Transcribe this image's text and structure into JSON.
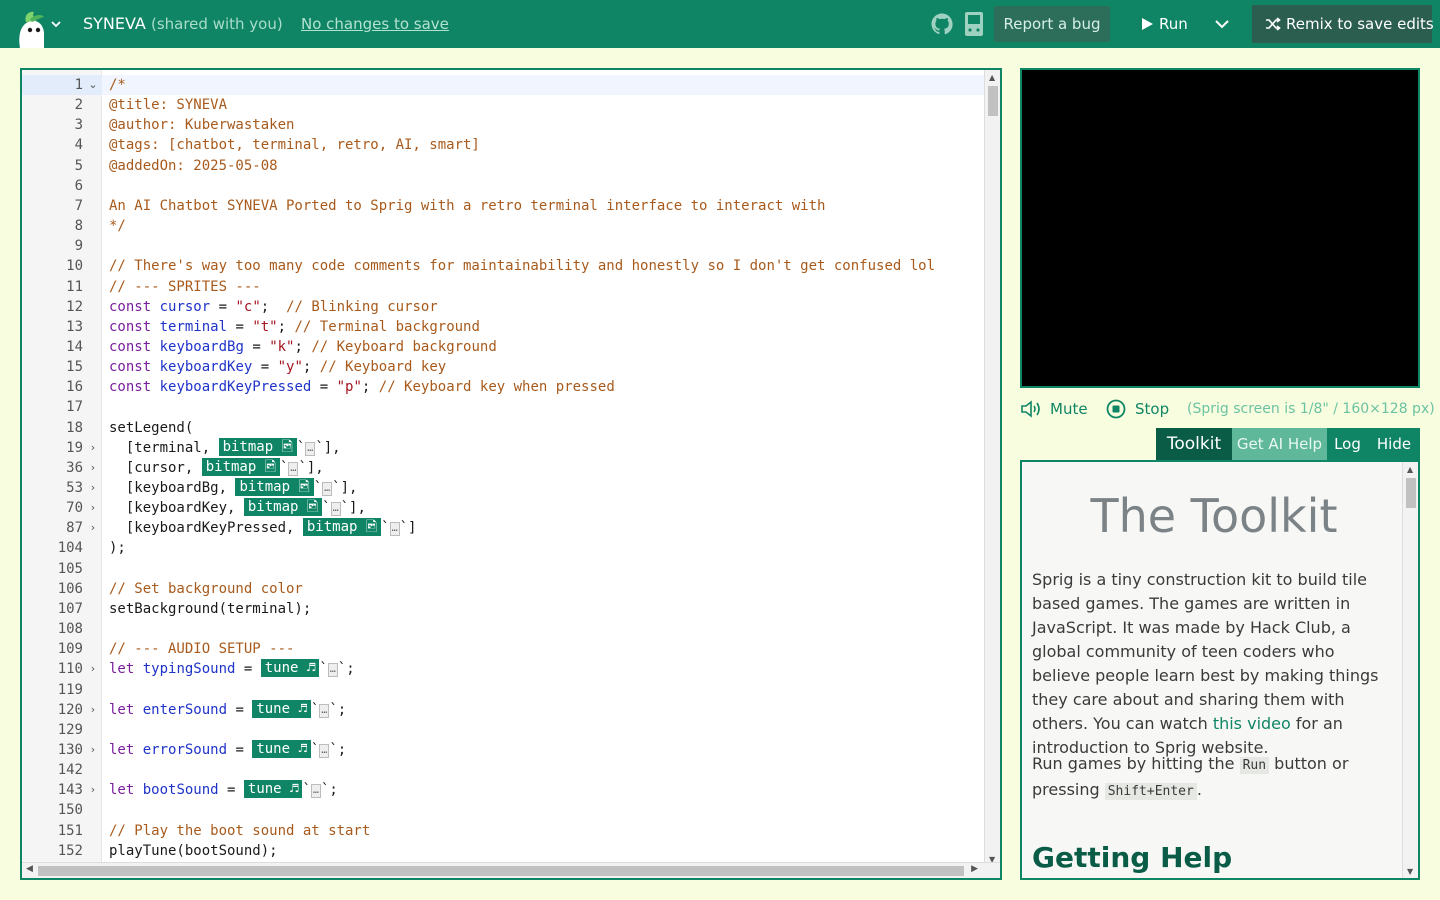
{
  "header": {
    "title": "SYNEVA",
    "shared": "(shared with you)",
    "save_status": "No changes to save",
    "report_bug": "Report a bug",
    "run": "Run",
    "remix": "Remix to save edits"
  },
  "editor": {
    "lines": [
      {
        "n": "1",
        "fold": "⌄",
        "html": "<span class=\"cm\">/*</span>"
      },
      {
        "n": "2",
        "html": "<span class=\"cm\">@title: SYNEVA</span>"
      },
      {
        "n": "3",
        "html": "<span class=\"cm\">@author: Kuberwastaken</span>"
      },
      {
        "n": "4",
        "html": "<span class=\"cm\">@tags: [chatbot, terminal, retro, AI, smart]</span>"
      },
      {
        "n": "5",
        "html": "<span class=\"cm\">@addedOn: 2025-05-08</span>"
      },
      {
        "n": "6",
        "html": ""
      },
      {
        "n": "7",
        "html": "<span class=\"cm\">An AI Chatbot SYNEVA Ported to Sprig with a retro terminal interface to interact with</span>"
      },
      {
        "n": "8",
        "html": "<span class=\"cm\">*/</span>"
      },
      {
        "n": "9",
        "html": ""
      },
      {
        "n": "10",
        "html": "<span class=\"cm\">// There's way too many code comments for maintainability and honestly so I don't get confused lol</span>"
      },
      {
        "n": "11",
        "html": "<span class=\"cm\">// --- SPRITES ---</span>"
      },
      {
        "n": "12",
        "html": "<span class=\"kw\">const</span> <span class=\"vr\">cursor</span> = <span class=\"st\">\"c\"</span>;  <span class=\"cm\">// Blinking cursor</span>"
      },
      {
        "n": "13",
        "html": "<span class=\"kw\">const</span> <span class=\"vr\">terminal</span> = <span class=\"st\">\"t\"</span>; <span class=\"cm\">// Terminal background</span>"
      },
      {
        "n": "14",
        "html": "<span class=\"kw\">const</span> <span class=\"vr\">keyboardBg</span> = <span class=\"st\">\"k\"</span>; <span class=\"cm\">// Keyboard background</span>"
      },
      {
        "n": "15",
        "html": "<span class=\"kw\">const</span> <span class=\"vr\">keyboardKey</span> = <span class=\"st\">\"y\"</span>; <span class=\"cm\">// Keyboard key</span>"
      },
      {
        "n": "16",
        "html": "<span class=\"kw\">const</span> <span class=\"vr\">keyboardKeyPressed</span> = <span class=\"st\">\"p\"</span>; <span class=\"cm\">// Keyboard key when pressed</span>"
      },
      {
        "n": "17",
        "html": ""
      },
      {
        "n": "18",
        "html": "setLegend("
      },
      {
        "n": "19",
        "fold": "›",
        "html": "  [terminal, <span class=\"pill\">bitmap 🖻</span>`<span class=\"dots\">…</span>`],"
      },
      {
        "n": "36",
        "fold": "›",
        "html": "  [cursor, <span class=\"pill\">bitmap 🖻</span>`<span class=\"dots\">…</span>`],"
      },
      {
        "n": "53",
        "fold": "›",
        "html": "  [keyboardBg, <span class=\"pill\">bitmap 🖻</span>`<span class=\"dots\">…</span>`],"
      },
      {
        "n": "70",
        "fold": "›",
        "html": "  [keyboardKey, <span class=\"pill\">bitmap 🖻</span>`<span class=\"dots\">…</span>`],"
      },
      {
        "n": "87",
        "fold": "›",
        "html": "  [keyboardKeyPressed, <span class=\"pill\">bitmap 🖻</span>`<span class=\"dots\">…</span>`]"
      },
      {
        "n": "104",
        "html": ");"
      },
      {
        "n": "105",
        "html": ""
      },
      {
        "n": "106",
        "html": "<span class=\"cm\">// Set background color</span>"
      },
      {
        "n": "107",
        "html": "setBackground(terminal);"
      },
      {
        "n": "108",
        "html": ""
      },
      {
        "n": "109",
        "html": "<span class=\"cm\">// --- AUDIO SETUP ---</span>"
      },
      {
        "n": "110",
        "fold": "›",
        "html": "<span class=\"kw\">let</span> <span class=\"vr\">typingSound</span> = <span class=\"pill\">tune ♬</span>`<span class=\"dots\">…</span>`;"
      },
      {
        "n": "119",
        "html": ""
      },
      {
        "n": "120",
        "fold": "›",
        "html": "<span class=\"kw\">let</span> <span class=\"vr\">enterSound</span> = <span class=\"pill\">tune ♬</span>`<span class=\"dots\">…</span>`;"
      },
      {
        "n": "129",
        "html": ""
      },
      {
        "n": "130",
        "fold": "›",
        "html": "<span class=\"kw\">let</span> <span class=\"vr\">errorSound</span> = <span class=\"pill\">tune ♬</span>`<span class=\"dots\">…</span>`;"
      },
      {
        "n": "142",
        "html": ""
      },
      {
        "n": "143",
        "fold": "›",
        "html": "<span class=\"kw\">let</span> <span class=\"vr\">bootSound</span> = <span class=\"pill\">tune ♬</span>`<span class=\"dots\">…</span>`;"
      },
      {
        "n": "150",
        "html": ""
      },
      {
        "n": "151",
        "html": "<span class=\"cm\">// Play the boot sound at start</span>"
      },
      {
        "n": "152",
        "html": "playTune(bootSound);"
      }
    ]
  },
  "screen": {
    "mute": "Mute",
    "stop": "Stop",
    "note": "(Sprig screen is 1/8\" / 160×128 px)"
  },
  "tabs": {
    "toolkit": "Toolkit",
    "ai_help": "Get AI Help",
    "log": "Log",
    "hide": "Hide"
  },
  "toolkit": {
    "title": "The Toolkit",
    "intro_before": "Sprig is a tiny construction kit to build tile based games. The games are written in JavaScript. It was made by Hack Club, a global community of teen coders who believe people learn best by making things they care about and sharing them with others. You can watch ",
    "intro_link": "this video",
    "intro_after": " for an introduction to Sprig website.",
    "run_before": "Run games by hitting the ",
    "run_code": "Run",
    "run_mid": " button or pressing ",
    "run_key": "Shift+Enter",
    "run_after": ".",
    "help_heading": "Getting Help"
  },
  "colors": {
    "brand": "#108565",
    "background": "#f7fdde"
  }
}
